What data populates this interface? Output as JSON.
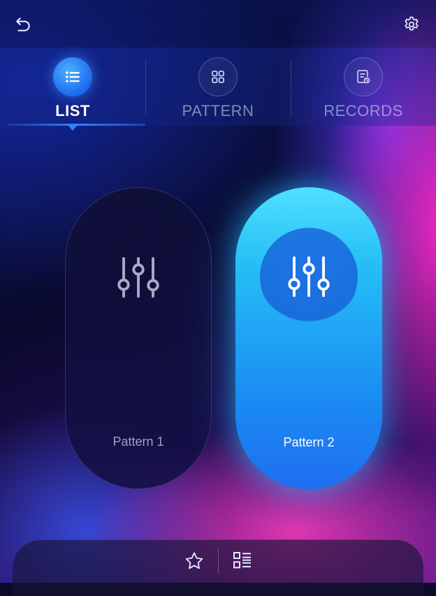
{
  "tabs": [
    {
      "label": "LIST",
      "icon": "list-icon",
      "active": true
    },
    {
      "label": "PATTERN",
      "icon": "grid-icon",
      "active": false
    },
    {
      "label": "RECORDS",
      "icon": "records-icon",
      "active": false
    }
  ],
  "cards": [
    {
      "label": "Pattern 1",
      "icon": "sliders-icon",
      "selected": false
    },
    {
      "label": "Pattern 2",
      "icon": "sliders-icon",
      "selected": true
    }
  ],
  "header": {
    "back_icon": "back-arrow-icon",
    "settings_icon": "gear-icon"
  },
  "bottom_bar": {
    "favorite_icon": "star-icon",
    "list_icon": "checklist-icon"
  },
  "colors": {
    "accent": "#2f86ff",
    "selected_card": "#26bff7",
    "pink_glow": "#ff28c8"
  }
}
